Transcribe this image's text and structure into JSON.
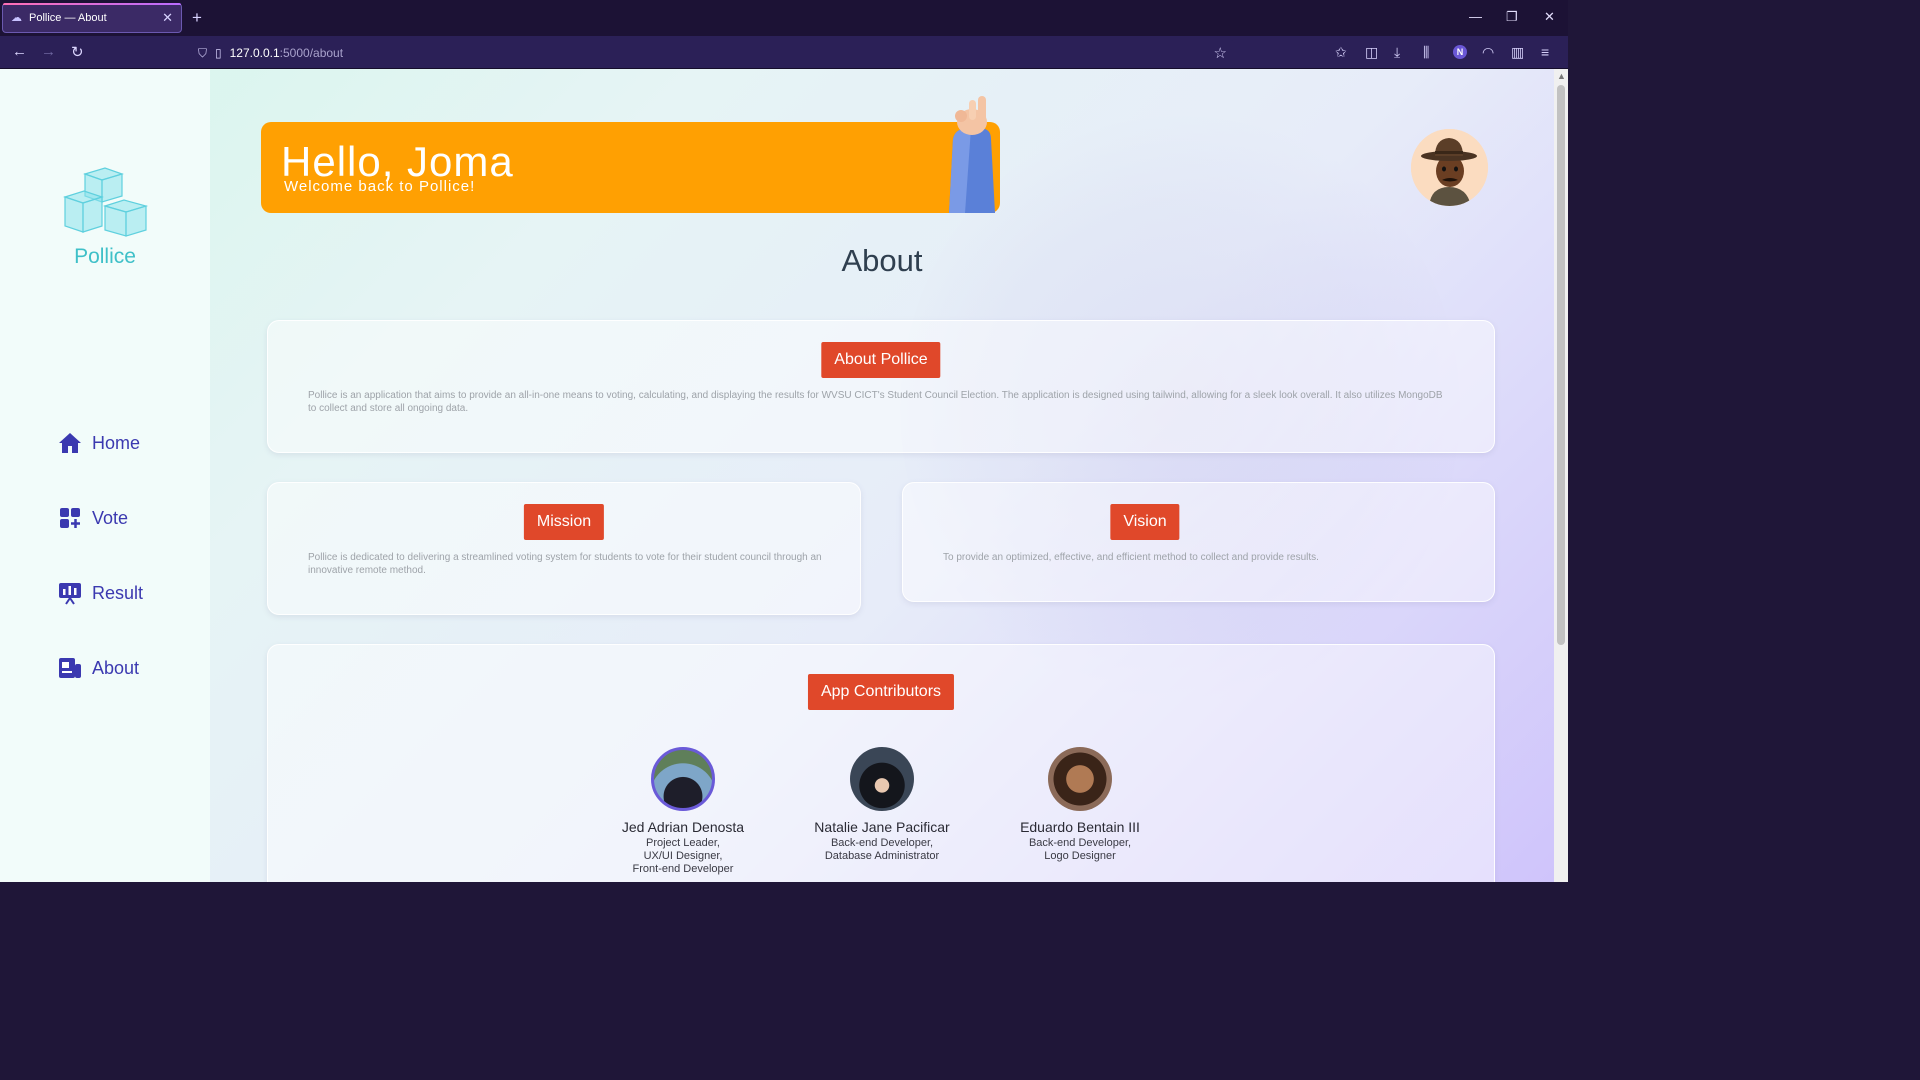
{
  "browser": {
    "tab_title": "Pollice — About",
    "url_host": "127.0.0.1",
    "url_path": ":5000/about"
  },
  "sidebar": {
    "brand": "Pollice",
    "items": [
      {
        "label": "Home",
        "icon": "home-icon"
      },
      {
        "label": "Vote",
        "icon": "vote-icon"
      },
      {
        "label": "Result",
        "icon": "result-icon"
      },
      {
        "label": "About",
        "icon": "about-icon"
      }
    ]
  },
  "banner": {
    "title": "Hello, Joma",
    "subtitle": "Welcome back to Pollice!"
  },
  "page": {
    "title": "About"
  },
  "about_card": {
    "heading": "About Pollice",
    "text": "Pollice is an application that aims to provide an all-in-one means to voting, calculating, and displaying the results for WVSU CICT's Student Council Election. The application is designed using tailwind, allowing for a sleek look overall. It also utilizes MongoDB to collect and store all ongoing data."
  },
  "mission_card": {
    "heading": "Mission",
    "text": "Pollice is dedicated to delivering a streamlined voting system for students to vote for their student council through an innovative remote method."
  },
  "vision_card": {
    "heading": "Vision",
    "text": "To provide an optimized, effective, and efficient method to collect and provide results."
  },
  "contributors": {
    "heading": "App Contributors",
    "people": [
      {
        "name": "Jed Adrian Denosta",
        "roles": [
          "Project Leader,",
          "UX/UI Designer,",
          "Front-end Developer"
        ]
      },
      {
        "name": "Natalie Jane Pacificar",
        "roles": [
          "Back-end Developer,",
          "Database Administrator"
        ]
      },
      {
        "name": "Eduardo Bentain III",
        "roles": [
          "Back-end Developer,",
          "Logo Designer"
        ]
      }
    ]
  },
  "colors": {
    "accent": "#e0482a",
    "banner": "#ffa002",
    "nav": "#3b39b0",
    "brand": "#3fc0c8"
  }
}
